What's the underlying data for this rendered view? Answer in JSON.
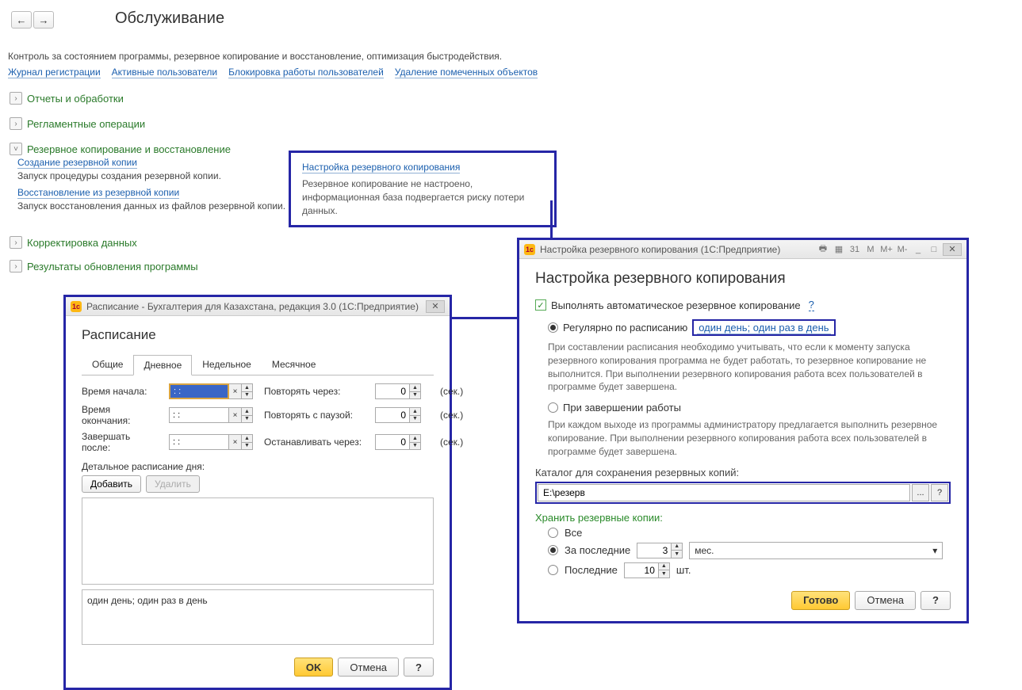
{
  "nav": {
    "back": "←",
    "fwd": "→"
  },
  "page": {
    "title": "Обслуживание",
    "subtitle": "Контроль за состоянием программы, резервное копирование и восстановление, оптимизация быстродействия."
  },
  "top_links": [
    "Журнал регистрации",
    "Активные пользователи",
    "Блокировка работы пользователей",
    "Удаление помеченных объектов"
  ],
  "sections": {
    "reports": "Отчеты и обработки",
    "reglament": "Регламентные операции",
    "backup": "Резервное копирование и восстановление",
    "correct": "Корректировка данных",
    "update": "Результаты обновления программы"
  },
  "backup_sub": {
    "create_link": "Создание резервной копии",
    "create_desc": "Запуск процедуры создания резервной копии.",
    "restore_link": "Восстановление из резервной копии",
    "restore_desc": "Запуск восстановления данных из файлов резервной копии."
  },
  "callout": {
    "link": "Настройка резервного копирования",
    "text": "Резервное копирование не настроено, информационная база подвергается риску потери данных."
  },
  "settings_dialog": {
    "titlebar": "Настройка резервного копирования  (1С:Предприятие)",
    "heading": "Настройка резервного копирования",
    "auto_checkbox": "Выполнять автоматическое резервное копирование",
    "radio_schedule": "Регулярно по расписанию",
    "schedule_link": "один день; один раз в день",
    "schedule_note": "При составлении расписания необходимо учитывать, что если к моменту запуска резервного копирования программа не будет работать, то резервное копирование не выполнится. При выполнении резервного копирования работа всех пользователей в программе будет завершена.",
    "radio_onclose": "При завершении работы",
    "onclose_note": "При каждом выходе из программы администратору предлагается выполнить резервное копирование. При выполнении резервного копирования работа всех пользователей в программе будет завершена.",
    "catalog_label": "Каталог для сохранения резервных копий:",
    "catalog_value": "E:\\резерв",
    "keep_header": "Хранить резервные копии:",
    "keep_all": "Все",
    "keep_recent": "За последние",
    "keep_recent_value": "3",
    "keep_recent_unit": "мес.",
    "keep_count": "Последние",
    "keep_count_value": "10",
    "keep_count_unit": "шт.",
    "btn_done": "Готово",
    "btn_cancel": "Отмена",
    "btn_help": "?",
    "tb_icons": {
      "m": "M",
      "mplus": "M+",
      "mminus": "M-",
      "min": "_",
      "max": "□",
      "close": "✕"
    }
  },
  "schedule_dialog": {
    "titlebar": "Расписание - Бухгалтерия для Казахстана, редакция 3.0  (1С:Предприятие)",
    "heading": "Расписание",
    "tabs": [
      "Общие",
      "Дневное",
      "Недельное",
      "Месячное"
    ],
    "labels": {
      "start": "Время начала:",
      "end": "Время окончания:",
      "finish_after": "Завершать после:",
      "repeat_every": "Повторять через:",
      "repeat_pause": "Повторять с паузой:",
      "stop_after": "Останавливать через:",
      "sec": "(сек.)",
      "detailed": "Детальное расписание дня:"
    },
    "start_value": ": :",
    "end_value": ": :",
    "finish_value": ": :",
    "repeat_every_value": "0",
    "repeat_pause_value": "0",
    "stop_after_value": "0",
    "add_btn": "Добавить",
    "del_btn": "Удалить",
    "summary": "один день; один раз в день",
    "ok": "OK",
    "cancel": "Отмена",
    "help": "?"
  }
}
